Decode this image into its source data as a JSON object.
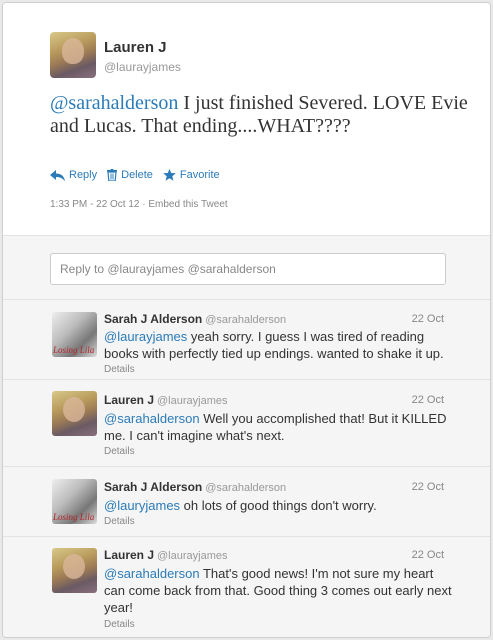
{
  "main_tweet": {
    "name": "Lauren J",
    "handle": "@laurayjames",
    "mention": "@sarahalderson",
    "text": " I just finished Severed. LOVE Evie and Lucas. That ending....WHAT????",
    "actions": {
      "reply": "Reply",
      "delete": "Delete",
      "favorite": "Favorite"
    },
    "meta": "1:33 PM - 22 Oct 12 · Embed this Tweet"
  },
  "reply_box": {
    "placeholder": "Reply to @laurayjames @sarahalderson"
  },
  "replies": [
    {
      "name": "Sarah J Alderson",
      "handle": "@sarahalderson",
      "date": "22 Oct",
      "mention": "@laurayjames",
      "text": " yeah sorry. I guess I was tired of reading books with perfectly tied up endings. wanted to shake it up.",
      "details": "Details"
    },
    {
      "name": "Lauren J",
      "handle": "@laurayjames",
      "date": "22 Oct",
      "mention": "@sarahalderson",
      "text": " Well you accomplished that! But it KILLED me. I can't imagine what's next.",
      "details": "Details"
    },
    {
      "name": "Sarah J Alderson",
      "handle": "@sarahalderson",
      "date": "22 Oct",
      "mention": "@lauryjames",
      "text": " oh lots of good things don't worry.",
      "details": "Details"
    },
    {
      "name": "Lauren J",
      "handle": "@laurayjames",
      "date": "22 Oct",
      "mention": "@sarahalderson",
      "text": " That's good news! I'm not sure my heart can come back from that. Good thing 3 comes out early next year!",
      "details": "Details"
    }
  ],
  "avatar_text": {
    "sarah": "Losing Lila"
  },
  "colors": {
    "link": "#2b7bb9",
    "text": "#333333",
    "muted": "#888888",
    "panel": "#f5f5f5"
  },
  "icons": {
    "reply": "reply-arrow-icon",
    "delete": "trash-icon",
    "favorite": "star-icon"
  }
}
